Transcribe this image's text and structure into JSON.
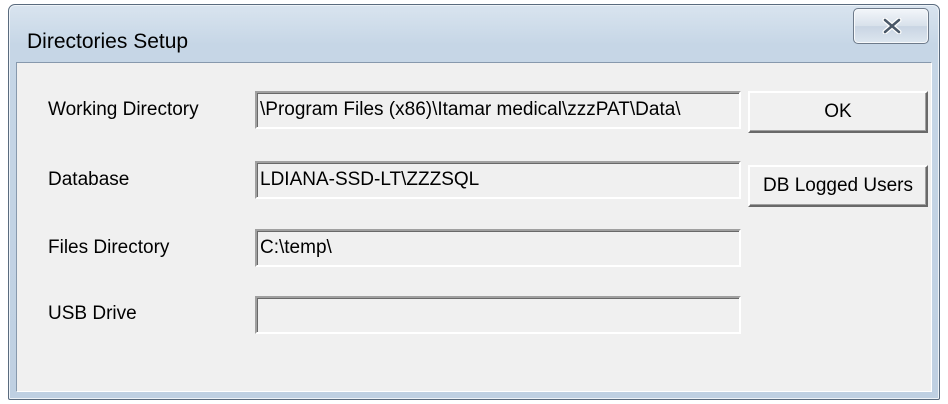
{
  "window": {
    "title": "Directories Setup",
    "close_icon": "close-x-icon"
  },
  "form": {
    "working_directory": {
      "label": "Working Directory",
      "value": "\\Program Files (x86)\\Itamar medical\\zzzPAT\\Data\\"
    },
    "database": {
      "label": "Database",
      "value": "LDIANA-SSD-LT\\ZZZSQL"
    },
    "files_directory": {
      "label": "Files Directory",
      "value": "C:\\temp\\"
    },
    "usb_drive": {
      "label": "USB Drive",
      "value": ""
    }
  },
  "buttons": {
    "ok_label": "OK",
    "db_logged_users_label": "DB Logged Users"
  },
  "colors": {
    "titlebar": "#c6d6e6",
    "client": "#f0f0f0"
  }
}
